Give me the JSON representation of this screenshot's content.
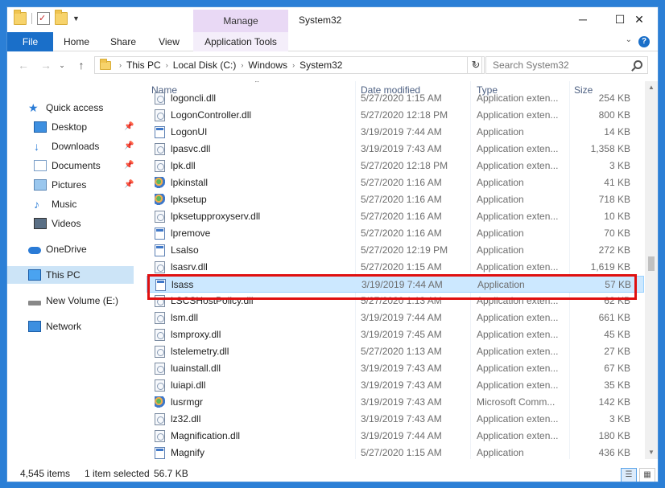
{
  "window": {
    "title": "System32",
    "manage_label": "Manage",
    "minimize": "─",
    "maximize": "☐",
    "close": "✕"
  },
  "ribbon": {
    "tabs": [
      "File",
      "Home",
      "Share",
      "View",
      "Application Tools"
    ]
  },
  "address": {
    "crumbs": [
      "This PC",
      "Local Disk (C:)",
      "Windows",
      "System32"
    ],
    "search_placeholder": "Search System32"
  },
  "sidebar": {
    "items": [
      {
        "label": "Quick access",
        "icon": "star-icon"
      },
      {
        "label": "Desktop",
        "icon": "desktop-icon",
        "pinned": true
      },
      {
        "label": "Downloads",
        "icon": "download-icon",
        "pinned": true
      },
      {
        "label": "Documents",
        "icon": "documents-icon",
        "pinned": true
      },
      {
        "label": "Pictures",
        "icon": "pictures-icon",
        "pinned": true
      },
      {
        "label": "Music",
        "icon": "music-icon"
      },
      {
        "label": "Videos",
        "icon": "videos-icon"
      },
      {
        "label": "OneDrive",
        "icon": "onedrive-icon"
      },
      {
        "label": "This PC",
        "icon": "this-pc-icon",
        "selected": true
      },
      {
        "label": "New Volume (E:)",
        "icon": "drive-icon"
      },
      {
        "label": "Network",
        "icon": "network-icon"
      }
    ]
  },
  "columns": {
    "name": "Name",
    "date": "Date modified",
    "type": "Type",
    "size": "Size"
  },
  "files": [
    {
      "name": "logoncli.dll",
      "date": "5/27/2020 1:15 AM",
      "type": "Application exten...",
      "size": "254 KB",
      "icon": "dll"
    },
    {
      "name": "LogonController.dll",
      "date": "5/27/2020 12:18 PM",
      "type": "Application exten...",
      "size": "800 KB",
      "icon": "dll"
    },
    {
      "name": "LogonUI",
      "date": "3/19/2019 7:44 AM",
      "type": "Application",
      "size": "14 KB",
      "icon": "exe"
    },
    {
      "name": "lpasvc.dll",
      "date": "3/19/2019 7:43 AM",
      "type": "Application exten...",
      "size": "1,358 KB",
      "icon": "dll"
    },
    {
      "name": "lpk.dll",
      "date": "5/27/2020 12:18 PM",
      "type": "Application exten...",
      "size": "3 KB",
      "icon": "dll"
    },
    {
      "name": "lpkinstall",
      "date": "5/27/2020 1:16 AM",
      "type": "Application",
      "size": "41 KB",
      "icon": "color"
    },
    {
      "name": "lpksetup",
      "date": "5/27/2020 1:16 AM",
      "type": "Application",
      "size": "718 KB",
      "icon": "color"
    },
    {
      "name": "lpksetupproxyserv.dll",
      "date": "5/27/2020 1:16 AM",
      "type": "Application exten...",
      "size": "10 KB",
      "icon": "dll"
    },
    {
      "name": "lpremove",
      "date": "5/27/2020 1:16 AM",
      "type": "Application",
      "size": "70 KB",
      "icon": "exe"
    },
    {
      "name": "Lsalso",
      "date": "5/27/2020 12:19 PM",
      "type": "Application",
      "size": "272 KB",
      "icon": "exe"
    },
    {
      "name": "lsasrv.dll",
      "date": "5/27/2020 1:15 AM",
      "type": "Application exten...",
      "size": "1,619 KB",
      "icon": "dll"
    },
    {
      "name": "lsass",
      "date": "3/19/2019 7:44 AM",
      "type": "Application",
      "size": "57 KB",
      "icon": "exe",
      "selected": true
    },
    {
      "name": "LSCSHostPolicy.dll",
      "date": "5/27/2020 1:13 AM",
      "type": "Application exten...",
      "size": "62 KB",
      "icon": "dll"
    },
    {
      "name": "lsm.dll",
      "date": "3/19/2019 7:44 AM",
      "type": "Application exten...",
      "size": "661 KB",
      "icon": "dll"
    },
    {
      "name": "lsmproxy.dll",
      "date": "3/19/2019 7:45 AM",
      "type": "Application exten...",
      "size": "45 KB",
      "icon": "dll"
    },
    {
      "name": "lstelemetry.dll",
      "date": "5/27/2020 1:13 AM",
      "type": "Application exten...",
      "size": "27 KB",
      "icon": "dll"
    },
    {
      "name": "luainstall.dll",
      "date": "3/19/2019 7:43 AM",
      "type": "Application exten...",
      "size": "67 KB",
      "icon": "dll"
    },
    {
      "name": "luiapi.dll",
      "date": "3/19/2019 7:43 AM",
      "type": "Application exten...",
      "size": "35 KB",
      "icon": "dll"
    },
    {
      "name": "lusrmgr",
      "date": "3/19/2019 7:43 AM",
      "type": "Microsoft Comm...",
      "size": "142 KB",
      "icon": "color"
    },
    {
      "name": "lz32.dll",
      "date": "3/19/2019 7:43 AM",
      "type": "Application exten...",
      "size": "3 KB",
      "icon": "dll"
    },
    {
      "name": "Magnification.dll",
      "date": "3/19/2019 7:44 AM",
      "type": "Application exten...",
      "size": "180 KB",
      "icon": "dll"
    },
    {
      "name": "Magnify",
      "date": "5/27/2020 1:15 AM",
      "type": "Application",
      "size": "436 KB",
      "icon": "exe"
    }
  ],
  "status": {
    "item_count": "4,545 items",
    "selection": "1 item selected",
    "selection_size": "56.7 KB"
  }
}
